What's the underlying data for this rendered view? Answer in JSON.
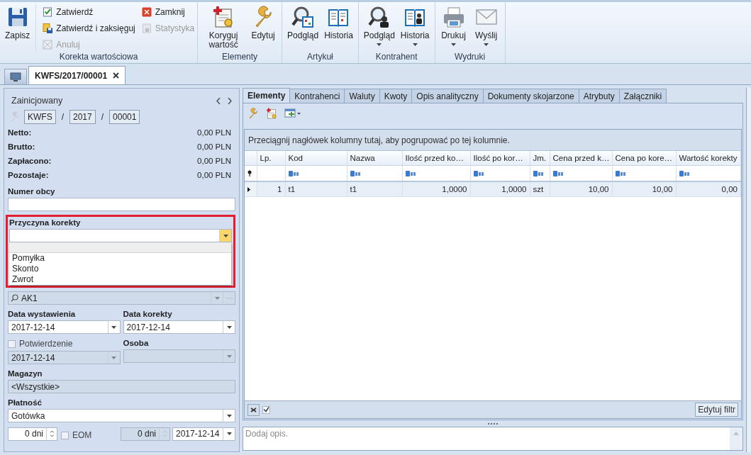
{
  "ribbon": {
    "groups": [
      {
        "label": "Korekta wartościowa",
        "buttons": [
          {
            "label": "Zapisz",
            "kind": "large",
            "disabled": false,
            "dropdown": false
          },
          {
            "label": "Zatwierdź",
            "kind": "small",
            "disabled": false,
            "dropdown": false
          },
          {
            "label": "Zatwierdź i zaksięguj",
            "kind": "small",
            "disabled": false,
            "dropdown": false
          },
          {
            "label": "Anuluj",
            "kind": "small",
            "disabled": true,
            "dropdown": false
          },
          {
            "label": "Zamknij",
            "kind": "small",
            "disabled": false,
            "dropdown": false
          },
          {
            "label": "Statystyka",
            "kind": "small",
            "disabled": true,
            "dropdown": false
          }
        ]
      },
      {
        "label": "Elementy",
        "buttons": [
          {
            "label": "Koryguj wartość",
            "kind": "large",
            "disabled": false,
            "dropdown": false
          },
          {
            "label": "Edytuj",
            "kind": "large",
            "disabled": false,
            "dropdown": false
          }
        ]
      },
      {
        "label": "Artykuł",
        "buttons": [
          {
            "label": "Podgląd",
            "kind": "large",
            "disabled": false,
            "dropdown": false
          },
          {
            "label": "Historia",
            "kind": "large",
            "disabled": false,
            "dropdown": false
          }
        ]
      },
      {
        "label": "Kontrahent",
        "buttons": [
          {
            "label": "Podgląd",
            "kind": "large",
            "disabled": false,
            "dropdown": true
          },
          {
            "label": "Historia",
            "kind": "large",
            "disabled": false,
            "dropdown": true
          }
        ]
      },
      {
        "label": "Wydruki",
        "buttons": [
          {
            "label": "Drukuj",
            "kind": "large",
            "disabled": false,
            "dropdown": true
          },
          {
            "label": "Wyślij",
            "kind": "large",
            "disabled": false,
            "dropdown": true
          }
        ]
      }
    ]
  },
  "document_tabs": [
    {
      "label": "KWFS/2017/00001",
      "selected": true
    }
  ],
  "form": {
    "status": "Zainicjowany",
    "number": [
      {
        "kind": "field",
        "text": "KWFS"
      },
      {
        "kind": "separator",
        "text": "/"
      },
      {
        "kind": "field",
        "text": "2017"
      },
      {
        "kind": "separator",
        "text": "/"
      },
      {
        "kind": "field",
        "text": "00001"
      }
    ],
    "summary": [
      {
        "label": "Netto:",
        "value": "0,00 PLN"
      },
      {
        "label": "Brutto:",
        "value": "0,00 PLN"
      },
      {
        "label": "Zapłacono:",
        "value": "0,00 PLN"
      },
      {
        "label": "Pozostaje:",
        "value": "0,00 PLN"
      }
    ],
    "numer_obcy": {
      "label": "Numer obcy"
    },
    "przyczyna_korekty": {
      "label": "Przyczyna korekty",
      "highlighted": true,
      "expanded": true,
      "options": [
        "Pomyłka",
        "Skonto",
        "Zwrot"
      ]
    },
    "kontrahent": {
      "value": "AK1"
    },
    "data_wystawienia": {
      "label": "Data wystawienia",
      "value": "2017-12-14"
    },
    "data_korekty": {
      "label": "Data korekty",
      "value": "2017-12-14"
    },
    "potwierdzenie": {
      "label": "Potwierdzenie",
      "checked": false,
      "value": "2017-12-14"
    },
    "osoba": {
      "label": "Osoba"
    },
    "magazyn": {
      "label": "Magazyn",
      "value": "<Wszystkie>"
    },
    "platnosc": {
      "label": "Płatność",
      "value": "Gotówka"
    },
    "termin": {
      "value": "0 dni"
    },
    "eom": {
      "label": "EOM",
      "checked": false
    },
    "termin_2": {
      "value": "0 dni"
    },
    "termin_data": {
      "value": "2017-12-14"
    }
  },
  "detail_tabs": [
    {
      "label": "Elementy",
      "selected": true
    },
    {
      "label": "Kontrahenci",
      "selected": false
    },
    {
      "label": "Waluty",
      "selected": false
    },
    {
      "label": "Kwoty",
      "selected": false
    },
    {
      "label": "Opis analityczny",
      "selected": false
    },
    {
      "label": "Dokumenty skojarzone",
      "selected": false
    },
    {
      "label": "Atrybuty",
      "selected": false
    },
    {
      "label": "Załączniki",
      "selected": false
    }
  ],
  "grid": {
    "group_hint": "Przeciągnij nagłówek kolumny tutaj, aby pogrupować po tej kolumnie.",
    "columns": [
      {
        "label": "Lp."
      },
      {
        "label": "Kod"
      },
      {
        "label": "Nazwa"
      },
      {
        "label": "Ilość przed ko…"
      },
      {
        "label": "Ilość po kor…"
      },
      {
        "label": "Jm."
      },
      {
        "label": "Cena przed k…"
      },
      {
        "label": "Cena po kore…"
      },
      {
        "label": "Wartość korekty"
      }
    ],
    "rows": [
      {
        "selected": true,
        "cells": [
          "1",
          "t1",
          "t1",
          "1,0000",
          "1,0000",
          "szt",
          "10,00",
          "10,00",
          "0,00"
        ]
      }
    ],
    "filter_checked": true,
    "edit_filter": "Edytuj filtr"
  },
  "description": {
    "placeholder": "Dodaj opis."
  }
}
